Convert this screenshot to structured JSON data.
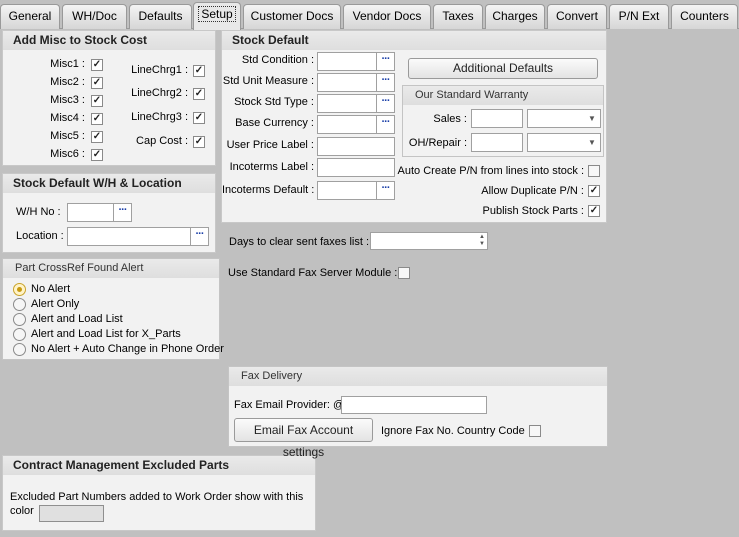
{
  "tabs": [
    "General",
    "WH/Doc",
    "Defaults",
    "Setup",
    "Customer Docs",
    "Vendor Docs",
    "Taxes",
    "Charges",
    "Convert",
    "P/N Ext",
    "Counters"
  ],
  "add_misc": {
    "title": "Add Misc to Stock Cost",
    "misc": [
      {
        "label": "Misc1 :",
        "checked": "✓"
      },
      {
        "label": "Misc2 :",
        "checked": "✓"
      },
      {
        "label": "Misc3 :",
        "checked": "✓"
      },
      {
        "label": "Misc4 :",
        "checked": "✓"
      },
      {
        "label": "Misc5 :",
        "checked": "✓"
      },
      {
        "label": "Misc6 :",
        "checked": "✓"
      }
    ],
    "line": [
      {
        "label": "LineChrg1 :",
        "checked": "✓"
      },
      {
        "label": "LineChrg2 :",
        "checked": "✓"
      },
      {
        "label": "LineChrg3 :",
        "checked": "✓"
      },
      {
        "label": "Cap Cost :",
        "checked": "✓"
      }
    ]
  },
  "stock_wh": {
    "title": "Stock Default W/H & Location",
    "wh_label": "W/H No :",
    "location_label": "Location :"
  },
  "crossref": {
    "title": "Part CrossRef Found Alert",
    "options": [
      "No Alert",
      "Alert Only",
      "Alert and Load List",
      "Alert and Load List for X_Parts",
      "No Alert + Auto Change in Phone Order"
    ]
  },
  "contract": {
    "title": "Contract Management Excluded Parts",
    "text1": "Excluded Part Numbers added to Work Order show with this",
    "text2": "color"
  },
  "stock_default": {
    "title": "Stock Default",
    "std_condition": "Std Condition :",
    "std_unit": "Std Unit Measure :",
    "stock_type": "Stock Std Type :",
    "base_currency": "Base Currency :",
    "user_price": "User Price Label :",
    "incoterms_label": "Incoterms Label :",
    "incoterms_default": "Incoterms Default :",
    "additional_defaults": "Additional Defaults",
    "warranty_title": "Our Standard Warranty",
    "sales": "Sales :",
    "oh_repair": "OH/Repair :",
    "auto_create": "Auto Create P/N from lines into stock :",
    "allow_dup": "Allow Duplicate P/N :",
    "publish": "Publish Stock Parts :"
  },
  "fax": {
    "days_clear": "Days to clear sent faxes list :",
    "std_fax": "Use Standard Fax Server Module :",
    "delivery_title": "Fax Delivery",
    "email_provider": "Fax Email Provider: @",
    "email_settings": "Email Fax Account settings",
    "ignore_country": "Ignore Fax No. Country Code"
  },
  "icons": {
    "ellipsis": "···",
    "check": "✓",
    "arrow": "▼",
    "up": "▲"
  }
}
